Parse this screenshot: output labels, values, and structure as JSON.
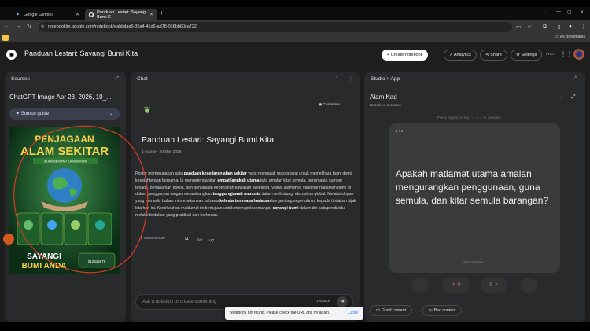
{
  "browser": {
    "tabs": [
      {
        "label": "Google Gemini",
        "icon": "gemini-icon"
      },
      {
        "label": "Panduan Lestari: Sayangi Bumi K",
        "icon": "notebooklm-icon"
      }
    ],
    "url": "notebooklm.google.com/notebook/eabbdae5-35a4-41d6-ad78-058bb60ca722",
    "bookmarks_label": "All Bookmarks"
  },
  "app": {
    "title": "Panduan Lestari: Sayangi Bumi Kita",
    "create_label": "Create notebook",
    "analytics_label": "Analytics",
    "share_label": "Share",
    "settings_label": "Settings",
    "pro_badge": "PRO"
  },
  "sources": {
    "header": "Sources",
    "item_title": "ChatGPT Image Apr 23, 2026, 10_...",
    "guide_label": "Source guide",
    "poster": {
      "title_line1": "PENJAGAAN",
      "title_line2": "ALAM SEKITAR",
      "subtitle": "ALAM SEKITAR KAWAN KITA",
      "slogan_line1": "SAYANGI",
      "slogan_line2": "BUMI ANDA",
      "contact": "012345678"
    }
  },
  "chat": {
    "header": "Chat",
    "customise_label": "Customise",
    "title": "Panduan Lestari: Sayangi Bumi Kita",
    "meta": "1 source · 20 May 2026",
    "body_parts": [
      "Poster ini merupakan satu ",
      "panduan kesedaran alam sekitar",
      " yang mengajak masyarakat untuk memelihara bumi demi kesejahteraan bersama. Ia mengetengahkan ",
      "empat langkah utama",
      " iaitu amalan kitar semula, penjimatan sumber tenaga, penanaman pokok, dan penjagaan kebersihan kawasan sekeliling. Visual utamanya yang memaparkan bumi di dalam genggaman tangan melambangkan ",
      "tanggungjawab manusia",
      " dalam melindungi ekosistem global. Melalui slogan yang menarik, bahan ini menekankan bahawa ",
      "kelestarian masa hadapan",
      " bergantung sepenuhnya kepada tindakan bijak kita hari ini. Keseluruhan maklumat ini bertujuan untuk memupuk semangat ",
      "sayangi bumi",
      " dalam diri setiap individu melalui tindakan yang praktikal dan berkesan."
    ],
    "save_note_label": "Save to note",
    "input_placeholder": "Ask a question or create something",
    "source_count": "1 source"
  },
  "studio": {
    "breadcrumb_studio": "Studio",
    "breadcrumb_sep": ">",
    "breadcrumb_app": "App",
    "card_title": "Alam Kad",
    "card_sub": "Based on 1 source",
    "hint": "Press 'Space' to flip, '← / →' to navigate",
    "counter": "1 / 5",
    "question": "Apakah matlamat utama amalan mengurangkan penggunaan, guna semula, dan kitar semula barangan?",
    "see_answer": "See answer",
    "wrong_count": "0",
    "right_count": "0",
    "good_label": "Good content",
    "bad_label": "Bad content"
  },
  "toast": {
    "message": "Notebook not found. Please check the URL and try again.",
    "close_label": "Close"
  }
}
